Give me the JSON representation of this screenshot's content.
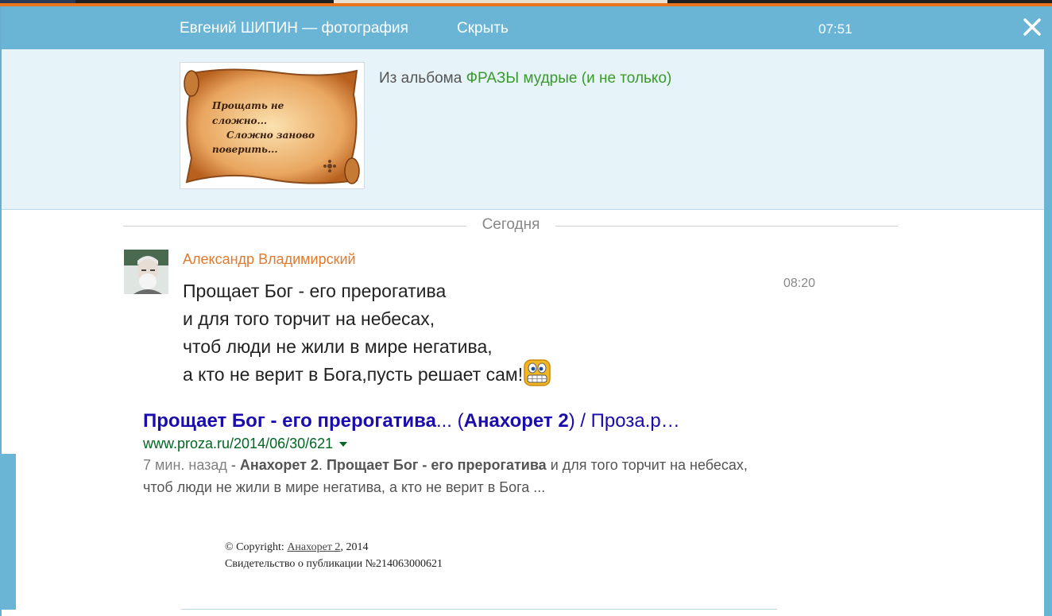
{
  "header": {
    "title": "Евгений ШИПИН — фотография",
    "hide_label": "Скрыть",
    "time": "07:51"
  },
  "album": {
    "prefix": "Из альбома",
    "name": "ФРАЗЫ мудрые (и не только)",
    "thumbnail_text": [
      "Прощать не",
      "сложно...",
      "Сложно заново",
      "поверить..."
    ]
  },
  "day_label": "Сегодня",
  "comment": {
    "author": "Александр Владимирский",
    "time": "08:20",
    "lines": [
      "Прощает Бог - его прерогатива",
      "и для того торчит на небесах,",
      "чтоб люди не жили в мире негатива,",
      "а кто не верит в Бога,пусть решает сам!"
    ],
    "emoji": "grin-emoji"
  },
  "search_result": {
    "title_bold": "Прощает Бог - его прерогатива",
    "title_mid": "... (",
    "title_bold2": "Анахорет 2",
    "title_end": ") / Проза.р…",
    "url": "www.proza.ru/2014/06/30/621",
    "age": "7 мин. назад",
    "sep": " - ",
    "snip_bold1": "Анахорет 2",
    "snip_dot": ". ",
    "snip_bold2": "Прощает Бог - его прерогатива",
    "snip_rest": " и для того торчит на небесах, чтоб люди не жили в мире негатива, а кто не верит в Бога ..."
  },
  "copyright": {
    "prefix": "© Copyright: ",
    "author_link": "Анахорет 2",
    "year": ", 2014",
    "certificate": "Свидетельство о публикации №214063000621"
  },
  "colors": {
    "header_bg": "#6ab5d6",
    "album_link": "#3a9a2a",
    "author": "#e07a2e",
    "result_title": "#1a0dab",
    "result_url": "#006621"
  }
}
